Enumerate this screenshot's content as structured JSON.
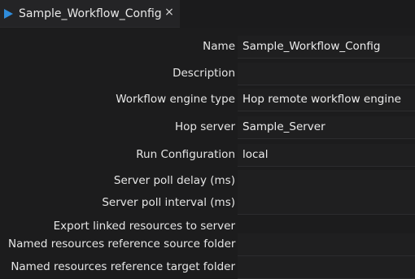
{
  "tab": {
    "title": "Sample_Workflow_Config",
    "play_icon": "play-icon",
    "close_glyph": "×"
  },
  "fields": {
    "name": {
      "label": "Name",
      "value": "Sample_Workflow_Config"
    },
    "description": {
      "label": "Description",
      "value": ""
    },
    "engine_type": {
      "label": "Workflow engine type",
      "value": "Hop remote workflow engine"
    },
    "hop_server": {
      "label": "Hop server",
      "value": "Sample_Server"
    },
    "run_configuration": {
      "label": "Run Configuration",
      "value": "local"
    },
    "poll_delay": {
      "label": "Server poll delay (ms)",
      "value": ""
    },
    "poll_interval": {
      "label": "Server poll interval (ms)",
      "value": ""
    },
    "export_linked": {
      "label": "Export linked resources to server"
    },
    "source_folder": {
      "label": "Named resources reference source folder",
      "value": ""
    },
    "target_folder": {
      "label": "Named resources reference target folder",
      "value": ""
    }
  },
  "colors": {
    "background": "#1b1b1c",
    "accent": "#2f8cdb",
    "text": "#e6e6e6"
  }
}
